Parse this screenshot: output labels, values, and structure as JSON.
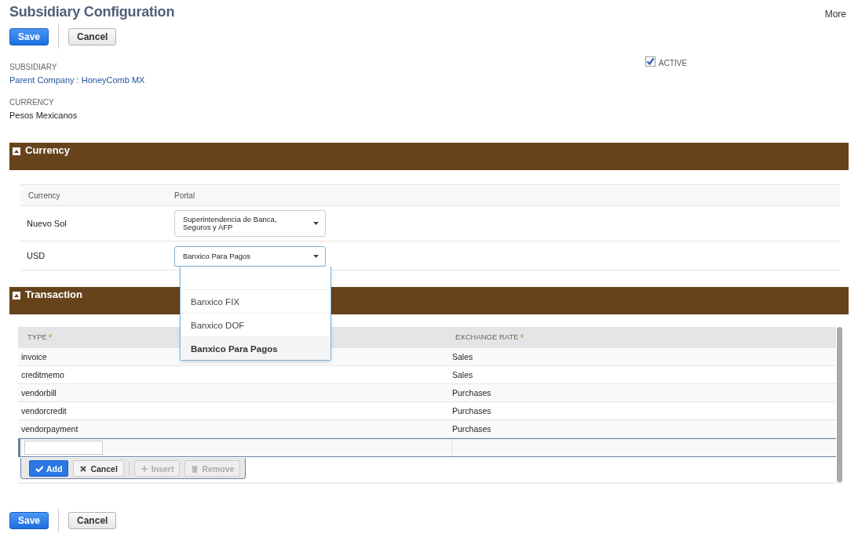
{
  "header": {
    "title": "Subsidiary Configuration",
    "more": "More"
  },
  "top_buttons": [
    {
      "label": "Save",
      "kind": "primary"
    },
    {
      "label": "Cancel",
      "kind": "secondary"
    }
  ],
  "fields": [
    {
      "label": "SUBSIDIARY",
      "value": "Parent Company : HoneyComb MX",
      "kind": "link"
    },
    {
      "label": "CURRENCY",
      "value": "Pesos Mexicanos",
      "kind": "text"
    }
  ],
  "active": {
    "label": "ACTIVE",
    "checked": true
  },
  "currency_section": {
    "title": "Currency",
    "expanded": true,
    "columns": [
      "Currency",
      "Portal"
    ],
    "rows": [
      {
        "currency": "Nuevo Sol",
        "portal": "Superintendencia de Banca, Seguros y AFP",
        "focused": false
      },
      {
        "currency": "USD",
        "portal": "Banxico Para Pagos",
        "focused": true
      }
    ]
  },
  "portal_menu": {
    "options": [
      {
        "label": "Banxico FIX",
        "selected": false
      },
      {
        "label": "Banxico DOF",
        "selected": false
      },
      {
        "label": "Banxico Para Pagos",
        "selected": true
      }
    ]
  },
  "transaction_section": {
    "title": "Transaction",
    "expanded": true,
    "columns": [
      {
        "label": "TYPE",
        "mark": "*"
      },
      {
        "label": "EXCHANGE RATE",
        "mark": "*"
      }
    ],
    "rows": [
      {
        "type": "invoice",
        "rate": "Sales"
      },
      {
        "type": "creditmemo",
        "rate": "Sales"
      },
      {
        "type": "vendorbill",
        "rate": "Purchases"
      },
      {
        "type": "vendorcredit",
        "rate": "Purchases"
      },
      {
        "type": "vendorpayment",
        "rate": "Purchases"
      }
    ],
    "edit_buttons": [
      {
        "label": "Add",
        "kind": "add",
        "disabled": false
      },
      {
        "label": "Cancel",
        "kind": "cancel",
        "disabled": false
      },
      {
        "label": "Insert",
        "kind": "insert",
        "disabled": true
      },
      {
        "label": "Remove",
        "kind": "remove",
        "disabled": true
      }
    ]
  },
  "bottom_buttons": [
    {
      "label": "Save",
      "kind": "primary"
    },
    {
      "label": "Cancel",
      "kind": "secondary"
    }
  ]
}
